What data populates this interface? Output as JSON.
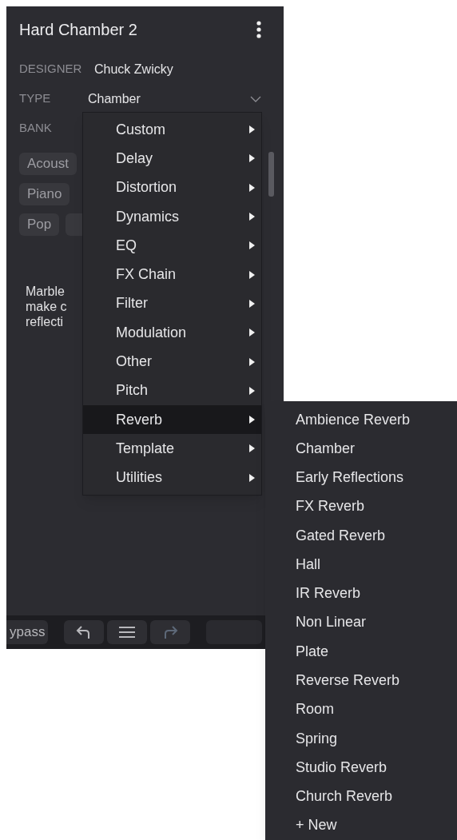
{
  "panel": {
    "title": "Hard Chamber 2",
    "fields": [
      {
        "label": "DESIGNER",
        "value": "Chuck Zwicky",
        "kind": "text"
      },
      {
        "label": "TYPE",
        "value": "Chamber",
        "kind": "dropdown"
      },
      {
        "label": "BANK",
        "kind": "text"
      }
    ],
    "tags": [
      "Acoust",
      "Piano",
      "Pop"
    ],
    "description": "Marble\nmake c\nreflecti",
    "toolbar": [
      {
        "kind": "text",
        "label": "ypass"
      },
      {
        "kind": "undo",
        "disabled": false
      },
      {
        "kind": "menu",
        "disabled": false
      },
      {
        "kind": "redo",
        "disabled": true
      },
      {
        "kind": "blank"
      }
    ]
  },
  "type_menu": {
    "items": [
      {
        "label": "Custom",
        "selected": false
      },
      {
        "label": "Delay",
        "selected": false
      },
      {
        "label": "Distortion",
        "selected": false
      },
      {
        "label": "Dynamics",
        "selected": false
      },
      {
        "label": "EQ",
        "selected": false
      },
      {
        "label": "FX Chain",
        "selected": false
      },
      {
        "label": "Filter",
        "selected": false
      },
      {
        "label": "Modulation",
        "selected": false
      },
      {
        "label": "Other",
        "selected": false
      },
      {
        "label": "Pitch",
        "selected": false
      },
      {
        "label": "Reverb",
        "selected": true
      },
      {
        "label": "Template",
        "selected": false
      },
      {
        "label": "Utilities",
        "selected": false
      }
    ]
  },
  "submenu": {
    "items": [
      "Ambience Reverb",
      "Chamber",
      "Early Reflections",
      "FX Reverb",
      "Gated Reverb",
      "Hall",
      "IR Reverb",
      "Non Linear",
      "Plate",
      "Reverse Reverb",
      "Room",
      "Spring",
      "Studio Reverb",
      "Church Reverb",
      "+ New"
    ]
  }
}
